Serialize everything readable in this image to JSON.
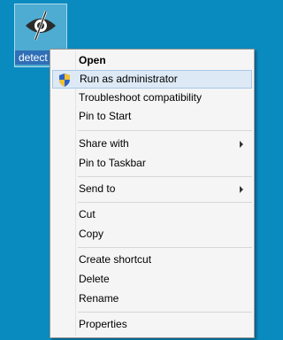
{
  "desktop_icon": {
    "label": "detect"
  },
  "menu": {
    "open": "Open",
    "run_as_admin": "Run as administrator",
    "troubleshoot": "Troubleshoot compatibility",
    "pin_start": "Pin to Start",
    "share_with": "Share with",
    "pin_taskbar": "Pin to Taskbar",
    "send_to": "Send to",
    "cut": "Cut",
    "copy": "Copy",
    "create_shortcut": "Create shortcut",
    "delete": "Delete",
    "rename": "Rename",
    "properties": "Properties"
  },
  "colors": {
    "desktop": "#0a8bbf",
    "hover_bg": "#dde9f5",
    "hover_border": "#a9c7e9"
  }
}
